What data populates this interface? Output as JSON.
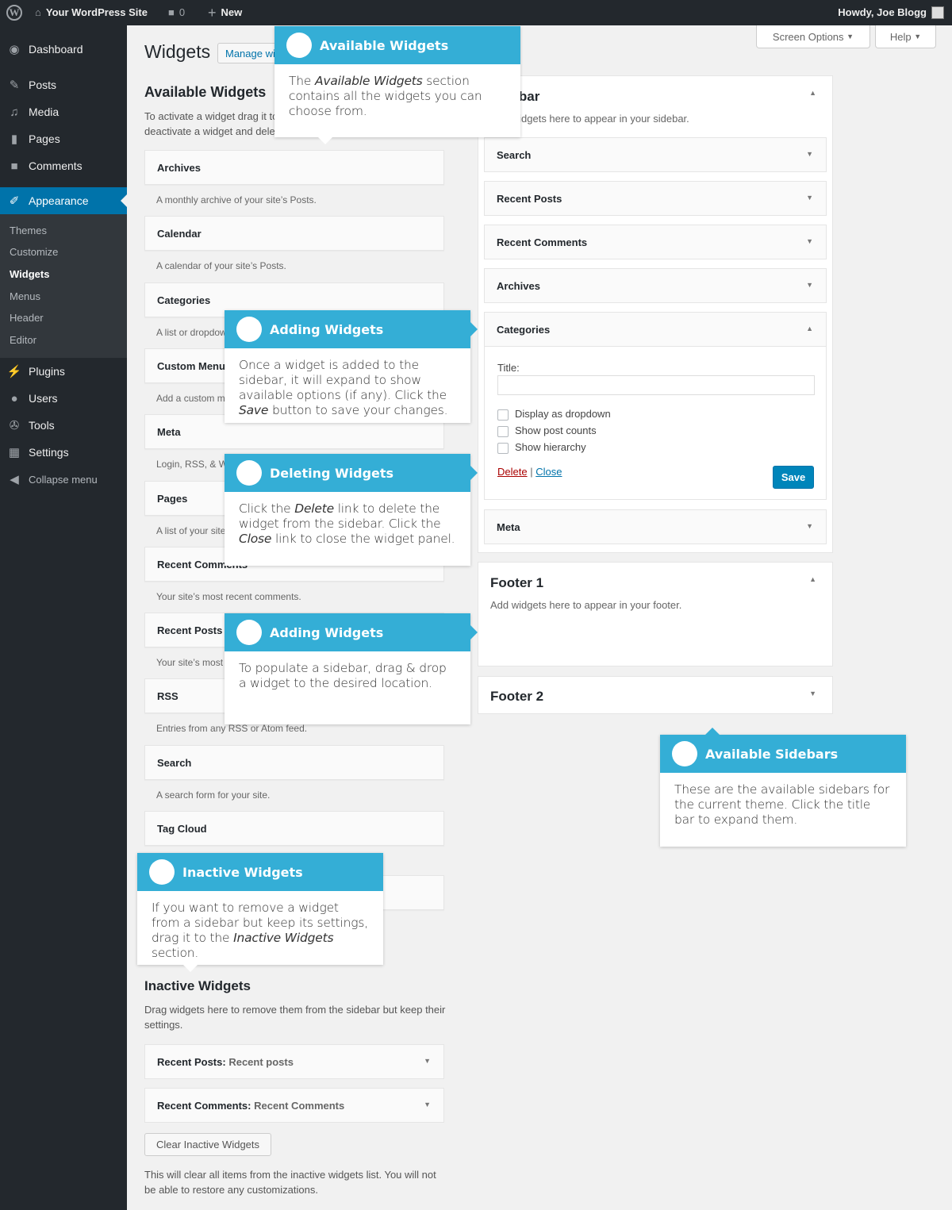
{
  "adminbar": {
    "site": "Your WordPress Site",
    "comments": "0",
    "new": "New",
    "howdy": "Howdy, Joe Blogg"
  },
  "menu": {
    "dashboard": "Dashboard",
    "posts": "Posts",
    "media": "Media",
    "pages": "Pages",
    "comments": "Comments",
    "appearance": "Appearance",
    "sub": [
      "Themes",
      "Customize",
      "Widgets",
      "Menus",
      "Header",
      "Editor"
    ],
    "plugins": "Plugins",
    "users": "Users",
    "tools": "Tools",
    "settings": "Settings",
    "collapse": "Collapse menu"
  },
  "header": {
    "title": "Widgets",
    "manage": "Manage with Live Preview",
    "screen_options": "Screen Options",
    "help": "Help"
  },
  "available": {
    "title": "Available Widgets",
    "desc1": "To activate a widget drag it to a sidebar or click on it. To",
    "desc2": "deactivate a widget and delete its settings, drag it back.",
    "widgets": [
      {
        "name": "Archives",
        "desc": "A monthly archive of your site’s Posts."
      },
      {
        "name": "Calendar",
        "desc": "A calendar of your site’s Posts."
      },
      {
        "name": "Categories",
        "desc": "A list or dropdown of categories."
      },
      {
        "name": "Custom Menu",
        "desc": "Add a custom menu to your sidebar."
      },
      {
        "name": "Meta",
        "desc": "Login, RSS, & WordPress.org links."
      },
      {
        "name": "Pages",
        "desc": "A list of your site’s Pages."
      },
      {
        "name": "Recent Comments",
        "desc": "Your site’s most recent comments."
      },
      {
        "name": "Recent Posts",
        "desc": "Your site’s most recent Posts."
      },
      {
        "name": "RSS",
        "desc": "Entries from any RSS or Atom feed."
      },
      {
        "name": "Search",
        "desc": "A search form for your site."
      },
      {
        "name": "Tag Cloud",
        "desc": ""
      }
    ]
  },
  "sidebar": {
    "title": "Sidebar",
    "desc": "Add widgets here to appear in your sidebar.",
    "widgets": [
      "Search",
      "Recent Posts",
      "Recent Comments",
      "Archives",
      "Categories",
      "Meta"
    ],
    "form": {
      "title_label": "Title:",
      "title_value": "",
      "checks": [
        "Display as dropdown",
        "Show post counts",
        "Show hierarchy"
      ],
      "delete": "Delete",
      "sep": "|",
      "close": "Close",
      "save": "Save"
    }
  },
  "footer1": {
    "title": "Footer 1",
    "desc": "Add widgets here to appear in your footer."
  },
  "footer2": {
    "title": "Footer 2"
  },
  "inactive": {
    "title": "Inactive Widgets",
    "desc": "Drag widgets here to remove them from the sidebar but keep their settings.",
    "items": [
      {
        "name": "Recent Posts:",
        "sub": "Recent posts"
      },
      {
        "name": "Recent Comments:",
        "sub": "Recent Comments"
      }
    ],
    "clear": "Clear Inactive Widgets",
    "note": "This will clear all items from the inactive widgets list. You will not be able to restore any customizations."
  },
  "callouts": {
    "available_widgets": {
      "title": "Available Widgets",
      "pre": "The ",
      "em": "Available Widgets",
      "post": " section contains all the widgets you can choose from."
    },
    "adding_widgets": {
      "title": "Adding Widgets",
      "pre": "Once a widget is added to the sidebar, it will expand to show available options (if any). Click the ",
      "em": "Save",
      "post": " button to save your changes."
    },
    "deleting_widgets": {
      "title": "Deleting Widgets",
      "pre": "Click the ",
      "em": "Delete",
      "mid": " link to delete the widget from the sidebar. Click the ",
      "em2": "Close",
      "post": " link to close the widget panel."
    },
    "adding_widgets_2": {
      "title": "Adding Widgets",
      "text": "To populate a sidebar, drag & drop a widget to the desired location."
    },
    "available_sidebars": {
      "title": "Available Sidebars",
      "text": "These are the available sidebars for the current theme. Click the title bar to expand them."
    },
    "inactive_widgets": {
      "title": "Inactive Widgets",
      "pre": "If you want to remove a widget from a sidebar but keep its settings, drag it to the ",
      "em": "Inactive Widgets",
      "post": " section."
    }
  },
  "colors": {
    "accent": "#0073aa",
    "callout": "#34aed6",
    "adminbar": "#23282d",
    "delete": "#a00"
  }
}
